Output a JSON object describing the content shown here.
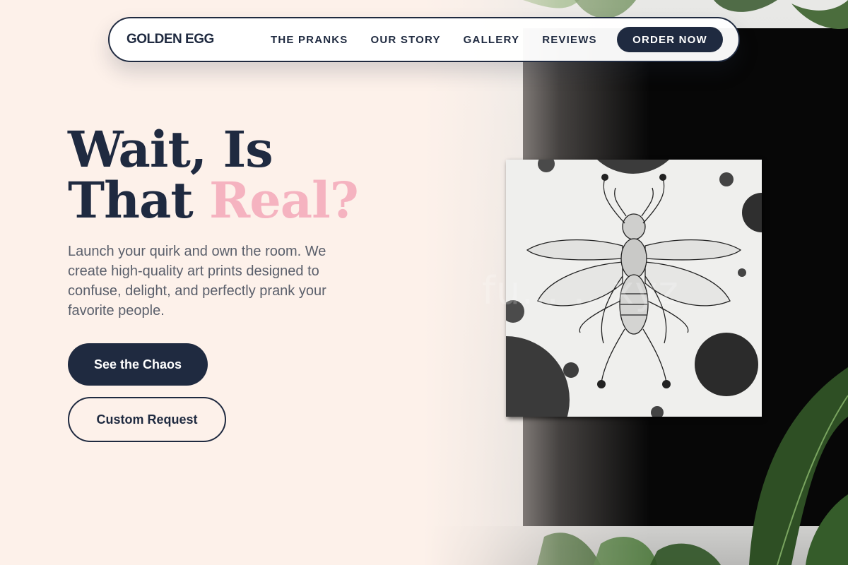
{
  "nav": {
    "logo": "GOLDEN EGG",
    "links": [
      "THE PRANKS",
      "OUR STORY",
      "GALLERY",
      "REVIEWS"
    ],
    "cta": "ORDER NOW"
  },
  "hero": {
    "headline_line1": "Wait, Is",
    "headline_line2_plain": "That ",
    "headline_line2_accent": "Real?",
    "subtitle": "Launch your quirk and own the room. We create high-quality art prints designed to confuse, delight, and perfectly prank your favorite people.",
    "primary_button": "See the Chaos",
    "secondary_button": "Custom Request"
  },
  "image": {
    "subject": "insect-art-print-photo",
    "watermark": "fu… …xyz"
  },
  "colors": {
    "navy": "#1f2a40",
    "pink_accent": "#f5b3c0",
    "background": "#fdf1ea"
  }
}
